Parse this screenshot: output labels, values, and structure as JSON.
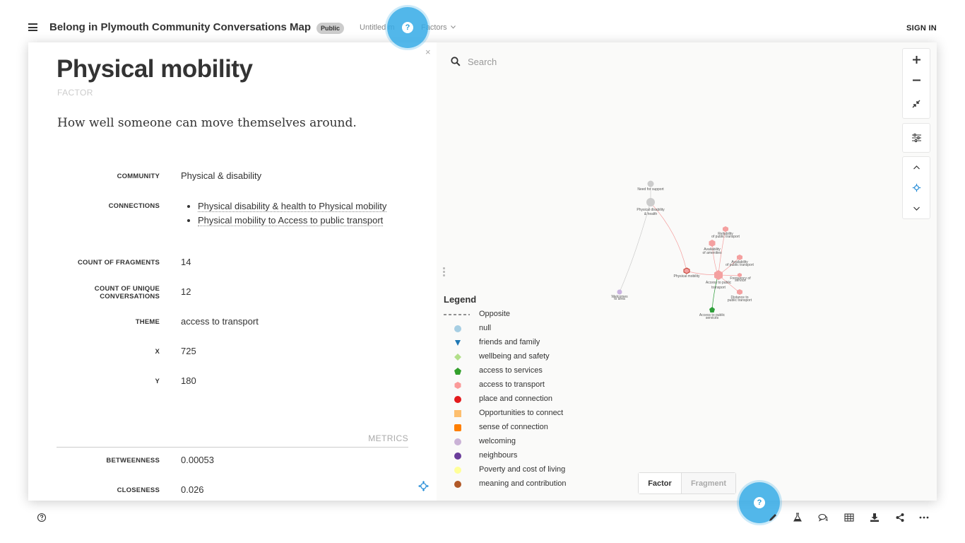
{
  "header": {
    "map_title": "Belong in Plymouth Community Conversations Map",
    "visibility_badge": "Public",
    "view_name": "Untitled m",
    "element_type_dropdown": "Factors",
    "help_icon_label": "?",
    "sign_in_label": "SIGN IN"
  },
  "detail": {
    "close_label": "×",
    "title": "Physical mobility",
    "type": "FACTOR",
    "description": "How well someone can move themselves around.",
    "attributes": {
      "community": {
        "label": "COMMUNITY",
        "value": "Physical & disability"
      },
      "connections": {
        "label": "CONNECTIONS",
        "items": [
          "Physical disability & health to Physical mobility",
          "Physical mobility to Access to public transport"
        ]
      },
      "count_fragments": {
        "label": "COUNT OF FRAGMENTS",
        "value": "14"
      },
      "count_conversations": {
        "label": "COUNT OF UNIQUE CONVERSATIONS",
        "value": "12"
      },
      "theme": {
        "label": "THEME",
        "value": "access to transport"
      },
      "x": {
        "label": "X",
        "value": "725"
      },
      "y": {
        "label": "Y",
        "value": "180"
      }
    },
    "metrics_heading": "METRICS",
    "metrics": {
      "betweenness": {
        "label": "BETWEENNESS",
        "value": "0.00053"
      },
      "closeness": {
        "label": "CLOSENESS",
        "value": "0.026"
      }
    }
  },
  "search": {
    "placeholder": "Search"
  },
  "graph": {
    "nodes": {
      "need_support": "Need for support",
      "phys_disability": "Physical disability",
      "phys_disability_2": "& health",
      "physical_mobility": "Physical mobility",
      "availability_amenities": "Availability",
      "availability_amenities_2": "of amenities",
      "reliability": "Reliability",
      "reliability_2": "of public transport",
      "availability_pt": "Availability",
      "availability_pt_2": "of public transport",
      "access_pt": "Access to public",
      "access_pt_2": "transport",
      "frequency": "Frequency of",
      "frequency_2": "service",
      "distance": "Distance to",
      "distance_2": "public transport",
      "access_services": "Access to public",
      "access_services_2": "services",
      "welcome": "Welcomes",
      "welcome_2": "to area"
    },
    "colors": {
      "transport": "#f4a0a0",
      "services": "#2e9e3a",
      "neutral": "#cccccc",
      "welcoming": "#c9b3e0"
    }
  },
  "legend": {
    "title": "Legend",
    "items": [
      {
        "label": "Opposite",
        "shape": "dashed-line",
        "color": "#555555"
      },
      {
        "label": "null",
        "shape": "circle",
        "color": "#a6cee3"
      },
      {
        "label": "friends and family",
        "shape": "triangle-down",
        "color": "#1f78b4"
      },
      {
        "label": "wellbeing and safety",
        "shape": "diamond",
        "color": "#b2df8a"
      },
      {
        "label": "access to services",
        "shape": "pentagon",
        "color": "#33a02c"
      },
      {
        "label": "access to transport",
        "shape": "hexagon",
        "color": "#fb9a99"
      },
      {
        "label": "place and connection",
        "shape": "circle",
        "color": "#e31a1c"
      },
      {
        "label": "Opportunities to connect",
        "shape": "square",
        "color": "#fdbf6f"
      },
      {
        "label": "sense of connection",
        "shape": "square-round",
        "color": "#ff7f00"
      },
      {
        "label": "welcoming",
        "shape": "circle",
        "color": "#cab2d6"
      },
      {
        "label": "neighbours",
        "shape": "circle",
        "color": "#6a3d9a"
      },
      {
        "label": "Poverty and cost of living",
        "shape": "circle",
        "color": "#ffff99"
      },
      {
        "label": "meaning and contribution",
        "shape": "circle",
        "color": "#b15928"
      }
    ]
  },
  "mode_toggle": {
    "factor": "Factor",
    "fragment": "Fragment"
  }
}
